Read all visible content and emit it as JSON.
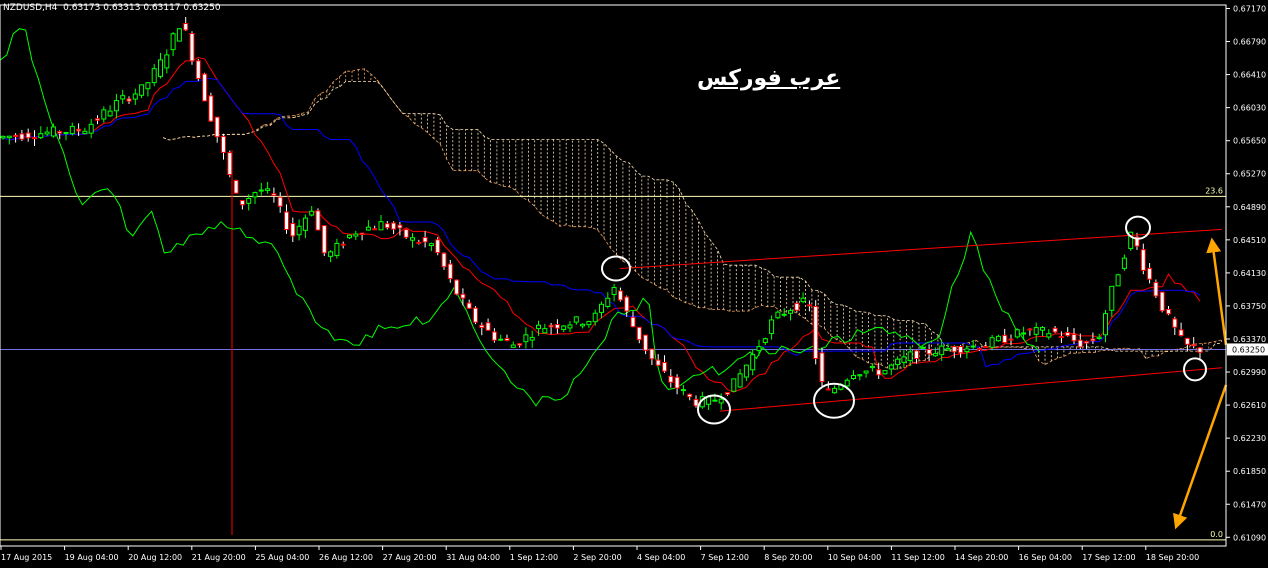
{
  "chart_data": {
    "type": "candlestick",
    "symbol_label": "NZDUSD,H4",
    "ohlc_label": "0.63173 0.63313 0.63117 0.63250",
    "watermark": "عرب فوركس",
    "current_price": "0.63250",
    "ylim": [
      0.6099,
      0.6721
    ],
    "price_ticks": [
      "0.67170",
      "0.66790",
      "0.66410",
      "0.66030",
      "0.65650",
      "0.65270",
      "0.64890",
      "0.64510",
      "0.64130",
      "0.63750",
      "0.63370",
      "0.62990",
      "0.62610",
      "0.62230",
      "0.61850",
      "0.61470",
      "0.61090"
    ],
    "time_labels": [
      "17 Aug 2015",
      "19 Aug 04:00",
      "20 Aug 12:00",
      "21 Aug 20:00",
      "25 Aug 04:00",
      "26 Aug 12:00",
      "27 Aug 20:00",
      "31 Aug 04:00",
      "1 Sep 12:00",
      "2 Sep 20:00",
      "4 Sep 04:00",
      "7 Sep 12:00",
      "8 Sep 20:00",
      "10 Sep 04:00",
      "11 Sep 12:00",
      "14 Sep 20:00",
      "16 Sep 04:00",
      "17 Sep 12:00",
      "18 Sep 20:00"
    ],
    "fib_levels": [
      {
        "label": "23.6",
        "price": 0.6501
      },
      {
        "label": "0.0",
        "price": 0.6106
      }
    ],
    "colors": {
      "bull": "#00ff00",
      "bear": "#ff0000",
      "tenkan": "#ff0000",
      "kijun": "#0000ff",
      "chikou": "#00ff00",
      "kumo_a": "#f4a460",
      "kumo_b": "#ffe4b5",
      "fib": "#ffffb4",
      "trend": "#ff0000",
      "arrow": "#ffa500",
      "circle": "#ffffff"
    }
  }
}
